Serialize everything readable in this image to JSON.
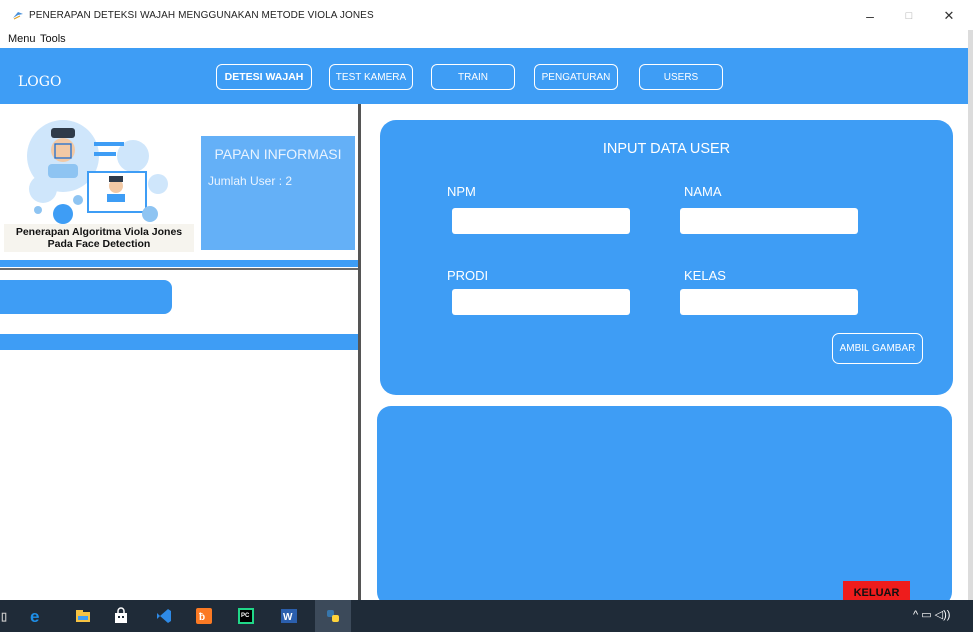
{
  "window": {
    "title": "PENERAPAN DETEKSI WAJAH MENGGUNAKAN METODE VIOLA JONES",
    "minimize": "–",
    "maximize": "□",
    "close": "✕"
  },
  "menubar": {
    "items": [
      "Menu",
      "Tools"
    ]
  },
  "header": {
    "logo": "LOGO",
    "nav": [
      "DETESI WAJAH",
      "TEST KAMERA",
      "TRAIN",
      "PENGATURAN",
      "USERS"
    ]
  },
  "left": {
    "caption_line1": "Penerapan Algoritma Viola Jones",
    "caption_line2": "Pada Face Detection",
    "info_title": "PAPAN INFORMASI",
    "info_label": "Jumlah User   : 2"
  },
  "form": {
    "title": "INPUT DATA USER",
    "npm_label": "NPM",
    "nama_label": "NAMA",
    "prodi_label": "PRODI",
    "kelas_label": "KELAS",
    "npm_value": "",
    "nama_value": "",
    "prodi_value": "",
    "kelas_value": "",
    "ambil_button": "AMBIL GAMBAR"
  },
  "keluar_button": "KELUAR",
  "colors": {
    "primary": "#3e9df5",
    "info_card": "#64b0f7",
    "danger": "#ee1c1c",
    "taskbar": "#1f2b38"
  },
  "taskbar": {
    "icons": [
      "edge-icon",
      "file-explorer-icon",
      "store-icon",
      "vscode-icon",
      "xampp-icon",
      "pycharm-icon",
      "word-icon",
      "python-icon"
    ]
  }
}
